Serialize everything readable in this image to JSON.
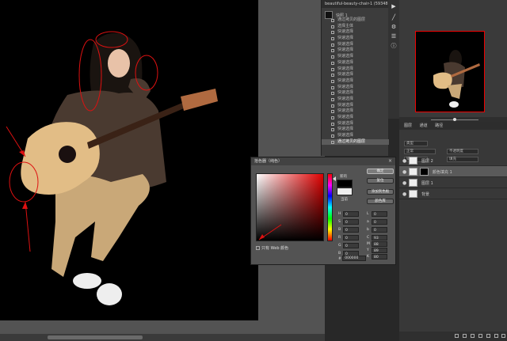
{
  "history": {
    "tab_label": "beautiful-beauty-chair-1 (59348…",
    "snapshot_label": "快照 1",
    "items": [
      "通过拷贝的图层",
      "选择主体",
      "快速选择",
      "快速选择",
      "快速选择",
      "快速选择",
      "快速选择",
      "快速选择",
      "快速选择",
      "快速选择",
      "快速选择",
      "快速选择",
      "快速选择",
      "快速选择",
      "快速选择",
      "快速选择",
      "快速选择",
      "快速选择",
      "快速选择",
      "快速选择",
      "通过拷贝的图层"
    ],
    "selected_index": 20
  },
  "layers": {
    "tabs": [
      "图层",
      "通道",
      "路径"
    ],
    "kind_label": "类型",
    "mode_label": "正常",
    "opacity_label": "不透明度",
    "lock_label": "锁定",
    "fill_label": "填充",
    "items": [
      {
        "name": "图层 2",
        "selected": false
      },
      {
        "name": "颜色填充 1",
        "selected": true
      },
      {
        "name": "图层 1",
        "selected": false
      },
      {
        "name": "背景",
        "selected": false
      }
    ]
  },
  "dialog": {
    "title": "拾色器（纯色）",
    "new_label": "新的",
    "current_label": "当前",
    "ok": "确定",
    "cancel": "复位",
    "add_swatch": "添加到色板",
    "libraries": "颜色库",
    "web_only": "只有 Web 颜色",
    "fields": [
      {
        "label": "H",
        "value": "0"
      },
      {
        "label": "S",
        "value": "0"
      },
      {
        "label": "B",
        "value": "0"
      },
      {
        "label": "R",
        "value": "0"
      },
      {
        "label": "G",
        "value": "0"
      },
      {
        "label": "B",
        "value": "0"
      }
    ],
    "fields_right": [
      {
        "label": "L",
        "value": "0"
      },
      {
        "label": "a",
        "value": "0"
      },
      {
        "label": "b",
        "value": "0"
      },
      {
        "label": "C",
        "value": "93"
      },
      {
        "label": "M",
        "value": "88"
      },
      {
        "label": "Y",
        "value": "89"
      },
      {
        "label": "K",
        "value": "80"
      }
    ],
    "hex_label": "#",
    "hex_value": "000000",
    "new_color": "#000000",
    "current_color": "#eeeeee"
  }
}
